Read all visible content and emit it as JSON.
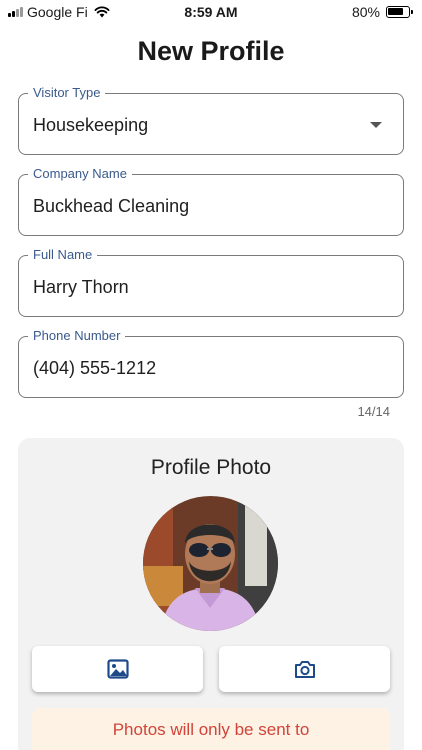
{
  "status_bar": {
    "carrier": "Google Fi",
    "time": "8:59 AM",
    "battery_percent": "80%",
    "battery_level": 0.8,
    "icons": [
      "signal-icon",
      "wifi-icon",
      "battery-icon"
    ]
  },
  "page": {
    "title": "New Profile"
  },
  "form": {
    "visitor_type": {
      "label": "Visitor Type",
      "value": "Housekeeping"
    },
    "company_name": {
      "label": "Company Name",
      "value": "Buckhead Cleaning"
    },
    "full_name": {
      "label": "Full Name",
      "value": "Harry Thorn"
    },
    "phone_number": {
      "label": "Phone Number",
      "value": "(404) 555-1212",
      "counter": "14/14"
    }
  },
  "photo_section": {
    "title": "Profile Photo",
    "gallery_icon": "image-icon",
    "camera_icon": "camera-icon",
    "notice": "Photos will only be sent to"
  },
  "colors": {
    "label": "#3a5a8c",
    "icon": "#1f4a8a",
    "notice_text": "#d0443a",
    "notice_bg": "#fdf2e4",
    "card_bg": "#f2f2f2"
  }
}
